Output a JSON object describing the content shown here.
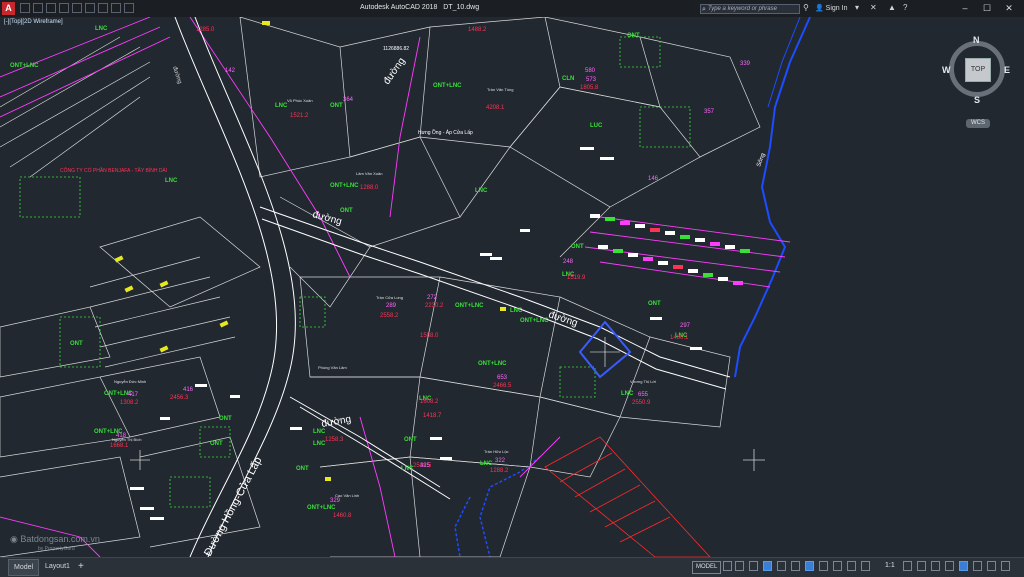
{
  "app": {
    "logo_letter": "A",
    "title": "Autodesk AutoCAD 2018",
    "filename": "DT_10.dwg"
  },
  "titlebar": {
    "search_placeholder": "Type a keyword or phrase",
    "signin": "Sign In"
  },
  "viewport_label": "[-][Top][2D Wireframe]",
  "viewcube": {
    "face": "TOP",
    "n": "N",
    "s": "S",
    "e": "E",
    "w": "W",
    "wcs": "WCS"
  },
  "tabs": {
    "model": "Model",
    "layout1": "Layout1"
  },
  "status": {
    "model": "MODEL",
    "scale": "1:1"
  },
  "colors": {
    "background": "#212830",
    "road": "#ffffff",
    "parcel": "#ff3dff",
    "label_green": "#38e038",
    "label_red": "#ff3355",
    "river": "#1e4cff"
  },
  "drawing": {
    "road_labels": [
      "đường",
      "đường",
      "đường",
      "đường",
      "đường"
    ],
    "road_name": "Đường Hồng-Cửa Lấp",
    "company": "CÔNG TY CỔ PHẦN BENJAFA - TÂY BÌNH DÁI",
    "place_label": "Hưng Ồng - Áp Cửa Lấp",
    "river_label": "Sông",
    "coord": "1126886.82",
    "land_codes": [
      "ONT+LNC",
      "LNC",
      "ONT",
      "CLN",
      "LUC",
      "ONT+LNC",
      "LNC",
      "ONT",
      "LNC",
      "ONT+LNC",
      "ONT",
      "LNC",
      "ONT+LNC",
      "ONT",
      "LNC",
      "ONT+LNC",
      "LNC",
      "ONT",
      "ONT",
      "LNC",
      "ONT+LNC",
      "LNC",
      "ONT+LNC",
      "ONT",
      "LNC",
      "ONT",
      "LNC",
      "ONT+LNC",
      "LNC",
      "ONT",
      "LNC",
      "ONT+LNC",
      "LNC",
      "ONT"
    ],
    "parcel_areas": [
      "1285.0",
      "1521.2",
      "1488.2",
      "1805.8",
      "4208.1",
      "1288.0",
      "2558.2",
      "2230.2",
      "1519.9",
      "1588.0",
      "2466.5",
      "1308.2",
      "2456.3",
      "1480.1",
      "1668.1",
      "1258.3",
      "1608.2",
      "2550.9",
      "2548.5",
      "1460.8",
      "1418.7",
      "1288.2"
    ],
    "parcel_numbers": [
      "364",
      "289",
      "272",
      "416",
      "418",
      "653",
      "655",
      "322",
      "417",
      "580",
      "329",
      "325",
      "573",
      "142",
      "146",
      "248",
      "297",
      "339",
      "357"
    ],
    "owner_names": [
      "Trần Cửa Long",
      "Phùng Văn Lâm",
      "Nguyễn Thị Bích",
      "Trần Hữu Lộc",
      "Võ Phúc Xuân",
      "Lâm Văn Xuân",
      "Vương Thị Lời",
      "Cao Văn Linh",
      "Trần Văn Tùng",
      "Nguyễn Đức Minh"
    ]
  }
}
